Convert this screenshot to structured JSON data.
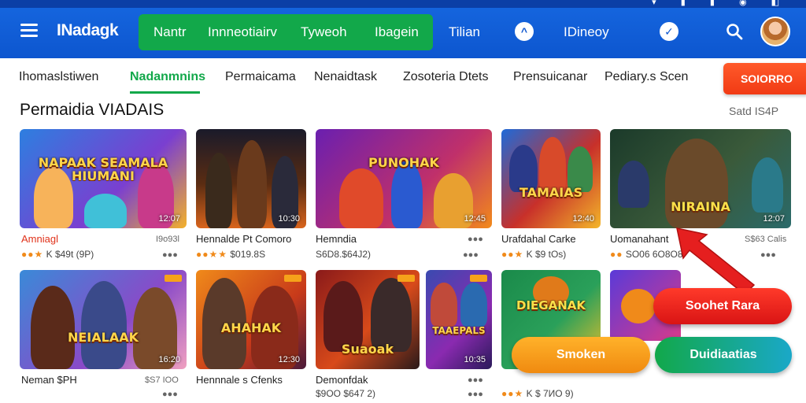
{
  "status_bar": {
    "icons": "▾ ▮ ▮ ◉ ◧"
  },
  "header": {
    "menu_icon": "hamburger-icon",
    "logo": "INadagk",
    "logo_tagline": "",
    "nav": [
      "Nantr",
      "Innneotiairv",
      "Tyweoh",
      "Ibagein",
      "Tilian"
    ],
    "extra": [
      {
        "icon": "chevron-up-icon",
        "label": "IDineoy"
      },
      {
        "icon": "shield-icon",
        "label": ""
      }
    ],
    "search_icon": "search-icon",
    "avatar_icon": "avatar"
  },
  "tabs": {
    "items": [
      "Ihomaslstiwen",
      "Nadanmnins",
      "Permaicama",
      "Nenaidtask",
      "Zosoteria Dtets",
      "Prensuicanar",
      "Pediary.s Scen"
    ],
    "active_index": 1,
    "cta": "SOIORRO"
  },
  "section": {
    "title": "Permaidia VIADAIS",
    "see_all": "Satd IS4P"
  },
  "cards_row1": [
    {
      "banner": "NAPAAK SEAMALA HIUMANI",
      "duration": "12:07",
      "title": "Amniagl",
      "meta": "I9o93l",
      "rating_text": "K $49t (9P)",
      "stars": "●●★"
    },
    {
      "banner": "",
      "duration": "10:30",
      "title": "Hennalde Pt Comoro",
      "meta": "",
      "rating_text": "$019.8S",
      "stars": "●●★★"
    },
    {
      "banner": "PUNOHAK",
      "duration": "12:45",
      "title": "Hemndia",
      "meta": "●●●",
      "rating_text": "S6D8.$64J2)",
      "stars": ""
    },
    {
      "banner": "TAMAIAS",
      "duration": "12:40",
      "title": "Urafdahal Carke",
      "meta": "",
      "rating_text": "K $9 tOs)",
      "stars": "●●★"
    },
    {
      "banner": "NIRAINA",
      "duration": "12:07",
      "title": "Uomanahant",
      "meta": "S$63 Calis",
      "rating_text": "SO06 6O8O8",
      "stars": "●●"
    }
  ],
  "cards_row2": [
    {
      "banner": "NEIALAAK",
      "duration": "16:20",
      "title": "Neman $PH",
      "meta": "$S7 IOO",
      "rating_text": "",
      "stars": ""
    },
    {
      "banner": "AHAHAK",
      "duration": "12:30",
      "title": "Hennnale s Cfenks",
      "meta": "",
      "rating_text": "",
      "stars": ""
    },
    {
      "banner": "Suaoak",
      "duration": "",
      "title": "Demonfdak",
      "meta": "",
      "rating_text": "$9OO $647 2)",
      "stars": ""
    },
    {
      "banner": "TAAEPALS",
      "duration": "10:35",
      "title": "",
      "meta": "",
      "rating_text": "",
      "stars": ""
    },
    {
      "banner": "DIEGANAK",
      "duration": "",
      "title": "",
      "meta": "",
      "rating_text": "K $ 7ИO 9)",
      "stars": "●●★"
    }
  ],
  "overlay": {
    "primary": "Soohet Rara",
    "secondary_left": "Smoken",
    "secondary_right": "Duidiaatias"
  },
  "colors": {
    "header": "#1667e0",
    "nav_green": "#12a84a",
    "cta_orange": "#f13a14",
    "red_pill": "#e51f1f",
    "orange_pill": "#f8a11c",
    "green_pill": "#18a860"
  }
}
